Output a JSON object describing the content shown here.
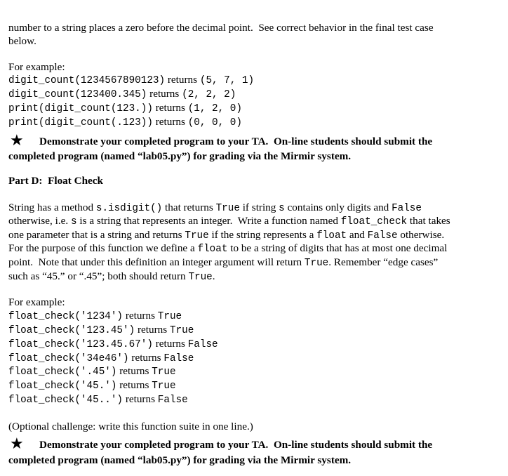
{
  "intro": {
    "line1": "number to a string places a zero before the decimal point.  See correct behavior in the final test case",
    "line2": "below."
  },
  "digit_examples": {
    "label": "For example:",
    "items": [
      {
        "code": "digit_count(1234567890123)",
        "word": " returns ",
        "result": "(5, 7, 1)"
      },
      {
        "code": "digit_count(123400.345)",
        "word": " returns ",
        "result": "(2, 2, 2)"
      },
      {
        "code": "print(digit_count(123.))",
        "word": " returns ",
        "result": "(1, 2, 0)"
      },
      {
        "code": "print(digit_count(.123))",
        "word": " returns ",
        "result": "(0, 0, 0)"
      }
    ]
  },
  "demo1": {
    "star": "★",
    "line1": "Demonstrate your completed program to your TA.  On-line students should submit the",
    "line2": "completed program (named “lab05.py”) for grading via the Mirmir system."
  },
  "part_d": {
    "heading": "Part D:  Float Check"
  },
  "description": {
    "l1": [
      {
        "t": "String has a method ",
        "m": false
      },
      {
        "t": "s.isdigit()",
        "m": true
      },
      {
        "t": " that returns ",
        "m": false
      },
      {
        "t": "True",
        "m": true
      },
      {
        "t": " if string ",
        "m": false
      },
      {
        "t": "s",
        "m": true
      },
      {
        "t": " contains only digits and ",
        "m": false
      },
      {
        "t": "False",
        "m": true
      }
    ],
    "l2": [
      {
        "t": "otherwise, i.e. ",
        "m": false
      },
      {
        "t": "s",
        "m": true
      },
      {
        "t": " is a string that represents an integer.  Write a function named ",
        "m": false
      },
      {
        "t": "float_check",
        "m": true
      },
      {
        "t": " that takes",
        "m": false
      }
    ],
    "l3": [
      {
        "t": "one parameter that is a string and returns ",
        "m": false
      },
      {
        "t": "True",
        "m": true
      },
      {
        "t": " if the string represents a ",
        "m": false
      },
      {
        "t": "float",
        "m": true
      },
      {
        "t": " and ",
        "m": false
      },
      {
        "t": "False",
        "m": true
      },
      {
        "t": " otherwise.",
        "m": false
      }
    ],
    "l4": [
      {
        "t": "For the purpose of this function we define a ",
        "m": false
      },
      {
        "t": "float",
        "m": true
      },
      {
        "t": " to be a string of digits that has at most one decimal",
        "m": false
      }
    ],
    "l5": [
      {
        "t": "point.  Note that under this definition an integer argument will return ",
        "m": false
      },
      {
        "t": "True",
        "m": true
      },
      {
        "t": ". Remember “edge cases”",
        "m": false
      }
    ],
    "l6": [
      {
        "t": "such as “45.” or “.45”; both should return ",
        "m": false
      },
      {
        "t": "True",
        "m": true
      },
      {
        "t": ".",
        "m": false
      }
    ]
  },
  "float_examples": {
    "label": "For example:",
    "items": [
      {
        "code": "float_check('1234')",
        "word": " returns ",
        "result": "True"
      },
      {
        "code": "float_check('123.45')",
        "word": " returns ",
        "result": "True"
      },
      {
        "code": "float_check('123.45.67')",
        "word": " returns ",
        "result": "False"
      },
      {
        "code": "float_check('34e46')",
        "word": " returns ",
        "result": "False"
      },
      {
        "code": "float_check('.45')",
        "word": " returns ",
        "result": "True"
      },
      {
        "code": "float_check('45.')",
        "word": " returns ",
        "result": "True"
      },
      {
        "code": "float_check('45..')",
        "word": " returns ",
        "result": "False"
      }
    ]
  },
  "optional": "(Optional challenge: write this function suite in one line.)",
  "demo2": {
    "star": "★",
    "line1": "Demonstrate your completed program to your TA.  On-line students should submit the",
    "line2": "completed program (named “lab05.py”) for grading via the Mirmir system."
  }
}
